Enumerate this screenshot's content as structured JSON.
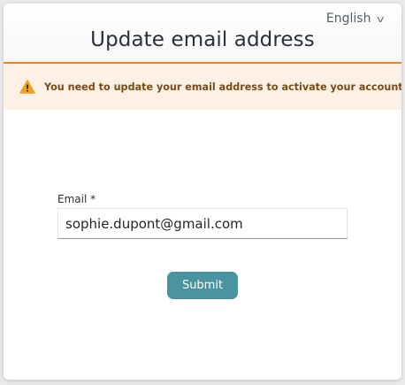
{
  "language_selector": {
    "label": "English",
    "chevron": "v",
    "icon": "chevron-down-icon"
  },
  "header": {
    "title": "Update email address"
  },
  "alert": {
    "icon": "warning-icon",
    "text": "You need to update your email address to activate your account.",
    "icon_color": "#f0a020",
    "background": "#fdf1e6"
  },
  "form": {
    "email_label": "Email *",
    "email_value": "sophie.dupont@gmail.com",
    "submit_label": "Submit"
  },
  "colors": {
    "accent_orange": "#e8832a",
    "button_teal": "#4a93a0"
  }
}
